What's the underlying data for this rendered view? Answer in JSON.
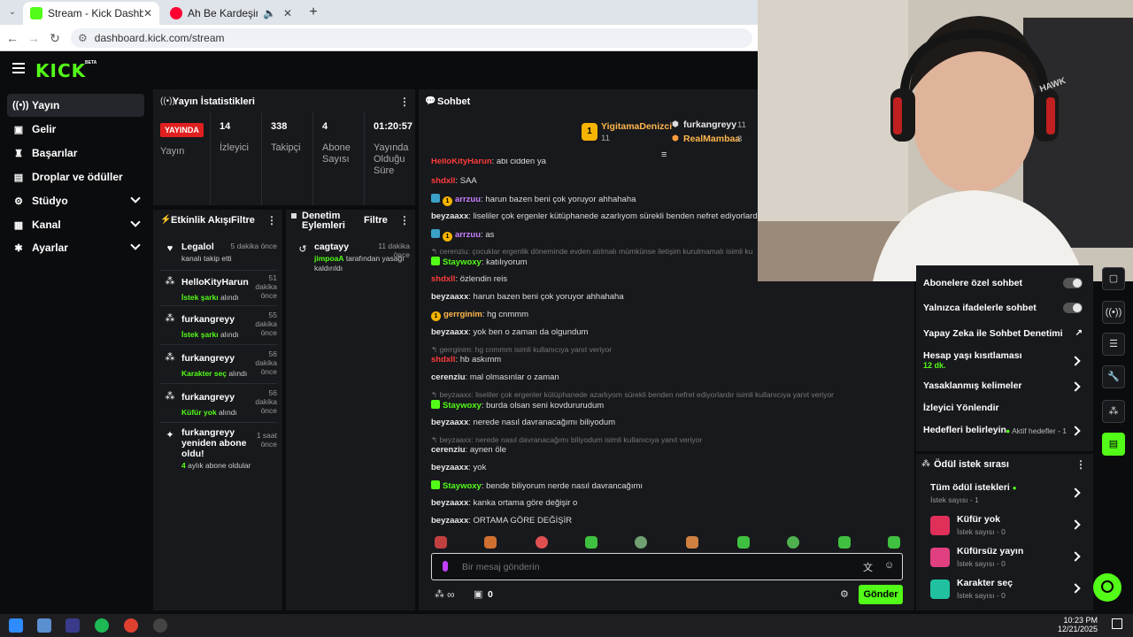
{
  "browser": {
    "tabs": [
      {
        "label": "Stream - Kick Dashboard",
        "active": true
      },
      {
        "label": "Ah Be Kardeşim - YouTube",
        "active": false
      }
    ],
    "url": "dashboard.kick.com/stream"
  },
  "brand": {
    "logo": "KICK",
    "beta": "BETA",
    "accent": "#53fc18"
  },
  "sidebar": {
    "items": [
      {
        "label": "Yayın",
        "icon": "broadcast-icon"
      },
      {
        "label": "Gelir",
        "icon": "wallet-icon"
      },
      {
        "label": "Başarılar",
        "icon": "trophy-icon"
      },
      {
        "label": "Droplar ve ödüller",
        "icon": "gift-icon"
      },
      {
        "label": "Stüdyo",
        "icon": "studio-icon"
      },
      {
        "label": "Kanal",
        "icon": "channel-icon"
      },
      {
        "label": "Ayarlar",
        "icon": "gear-icon"
      }
    ]
  },
  "stats": {
    "title": "Yayın İstatistikleri",
    "live_badge": "YAYINDA",
    "live_label": "Yayın",
    "viewers": {
      "value": "14",
      "label": "İzleyici"
    },
    "followers": {
      "value": "338",
      "label": "Takipçi"
    },
    "subs": {
      "value": "4",
      "label": "Abone Sayısı"
    },
    "uptime": {
      "value": "01:20:57",
      "label": "Yayında Olduğu Süre"
    }
  },
  "activity": {
    "title": "Etkinlik Akışı",
    "filter": "Filtre",
    "items": [
      {
        "user": "Legalol",
        "time": "5 dakika önce",
        "sub_plain": "kanalı takip etti",
        "sub_green": ""
      },
      {
        "user": "HelloKityHarun",
        "time": "51 dakika önce",
        "sub_green": "İstek şarkı",
        "sub_plain": " alındı"
      },
      {
        "user": "furkangreyy",
        "time": "55 dakika önce",
        "sub_green": "İstek şarkı",
        "sub_plain": " alındı"
      },
      {
        "user": "furkangreyy",
        "time": "56 dakika önce",
        "sub_green": "Karakter seç",
        "sub_plain": " alındı"
      },
      {
        "user": "furkangreyy",
        "time": "56 dakika önce",
        "sub_green": "Küfür yok",
        "sub_plain": " alındı"
      },
      {
        "user": "furkangreyy yeniden abone oldu!",
        "time": "1 saat önce",
        "sub_green": "4",
        "sub_plain": " aylık abone oldular"
      }
    ]
  },
  "moderation": {
    "title": "Denetim Eylemleri",
    "filter": "Filtre",
    "items": [
      {
        "user": "cagtayy",
        "time": "11 dakika önce",
        "actor": "jimpoaA",
        "text": " tarafından yasağı kaldırıldı"
      }
    ]
  },
  "chat": {
    "title": "Sohbet",
    "pinned": [
      {
        "user": "YigitamaDenizci",
        "count": "11"
      },
      {
        "user": "furkangreyy",
        "count": "11"
      },
      {
        "user": "RealMambaa",
        "count": "8"
      }
    ],
    "messages": [
      {
        "kind": "msg",
        "user": "HelloKityHarun",
        "color": "red",
        "text": ": abi cidden ya",
        "badge": ""
      },
      {
        "kind": "msg",
        "user": "shdxll",
        "color": "red",
        "text": ": SAA",
        "badge": ""
      },
      {
        "kind": "msg",
        "user": "arrzuu",
        "color": "purple",
        "text": ": harun bazen beni çok yoruyor ahhahaha",
        "badge": "both"
      },
      {
        "kind": "msg",
        "user": "beyzaaxx",
        "color": "white",
        "text": ": liseliler çok ergenler kütüphanede azarlıyom sürekli benden nefret ediyorlardır",
        "badge": ""
      },
      {
        "kind": "msg",
        "user": "arrzuu",
        "color": "purple",
        "text": ": as",
        "badge": "both"
      },
      {
        "kind": "reply",
        "text": "cerenziu: çocuklar ergenlik döneminde evden atılmalı mümkünse iletişim kurulmamalı isimli ku"
      },
      {
        "kind": "msg",
        "user": "Staywoxy",
        "color": "green",
        "text": ": katılıyorum",
        "badge": "gift"
      },
      {
        "kind": "msg",
        "user": "shdxll",
        "color": "red",
        "text": ": özlendin reis",
        "badge": ""
      },
      {
        "kind": "msg",
        "user": "beyzaaxx",
        "color": "white",
        "text": ": harun bazen beni çok yoruyor ahhahaha",
        "badge": ""
      },
      {
        "kind": "msg",
        "user": "gerrginim",
        "color": "gold",
        "text": ": hg cnmmm",
        "badge": "gold"
      },
      {
        "kind": "msg",
        "user": "beyzaaxx",
        "color": "white",
        "text": ": yok ben o zaman da olgundum",
        "badge": ""
      },
      {
        "kind": "reply",
        "text": "gerrginim: hg cnmmm isimli kullanıcıya yanıt veriyor"
      },
      {
        "kind": "msg",
        "user": "shdxll",
        "color": "red",
        "text": ": hb askımm",
        "badge": ""
      },
      {
        "kind": "msg",
        "user": "cerenziu",
        "color": "white",
        "text": ": mal olmasınlar o zaman",
        "badge": ""
      },
      {
        "kind": "reply",
        "text": "beyzaaxx: liseliler çok ergenler kütüphanede azarlıyom sürekli benden nefret ediyorlardır isimli kullanıcıya yanıt veriyor"
      },
      {
        "kind": "msg",
        "user": "Staywoxy",
        "color": "green",
        "text": ": burda olsan seni kovdururudum",
        "badge": "gift"
      },
      {
        "kind": "msg",
        "user": "beyzaaxx",
        "color": "white",
        "text": ": nerede nasıl davranacağımı biliyodum",
        "badge": ""
      },
      {
        "kind": "reply",
        "text": "beyzaaxx: nerede nasıl davranacağımı biliyodum isimli kullanıcıya yanıt veriyor"
      },
      {
        "kind": "msg",
        "user": "cerenziu",
        "color": "white",
        "text": ": aynen öle",
        "badge": ""
      },
      {
        "kind": "msg",
        "user": "beyzaaxx",
        "color": "white",
        "text": ": yok",
        "badge": ""
      },
      {
        "kind": "msg",
        "user": "Staywoxy",
        "color": "green",
        "text": ": bende biliyorum nerde nasıl davrancağımı",
        "badge": "gift"
      },
      {
        "kind": "msg",
        "user": "beyzaaxx",
        "color": "white",
        "text": ": kanka ortama göre değişir o",
        "badge": ""
      },
      {
        "kind": "msg",
        "user": "beyzaaxx",
        "color": "white",
        "text": ": ORTAMA GÖRE DEĞİŞİR",
        "badge": ""
      }
    ],
    "placeholder": "Bir mesaj gönderin",
    "send": "Gönder",
    "points": "∞",
    "gifts": "0"
  },
  "settings": {
    "rows": [
      {
        "label": "Abonelere özel sohbet",
        "control": "toggle"
      },
      {
        "label": "Yalnızca ifadelerle sohbet",
        "control": "toggle"
      },
      {
        "label": "Yapay Zeka ile Sohbet Denetimi",
        "control": "external"
      },
      {
        "label": "Hesap yaşı kısıtlaması",
        "sub": "12 dk.",
        "control": "arrow"
      },
      {
        "label": "Yasaklanmış kelimeler",
        "control": "arrow"
      },
      {
        "label": "İzleyici Yönlendir",
        "control": "none"
      },
      {
        "label": "Hedefleri belirleyin",
        "extra": "Aktif hedefler - 1",
        "control": "arrow"
      }
    ]
  },
  "rewards": {
    "title": "Ödül istek sırası",
    "items": [
      {
        "title": "Tüm ödül istekleri",
        "sub": "İstek sayısı - 1",
        "color": ""
      },
      {
        "title": "Küfür yok",
        "sub": "İstek sayısı - 0",
        "color": "#e0305a"
      },
      {
        "title": "Küfürsüz yayın",
        "sub": "İstek sayısı - 0",
        "color": "#e04080"
      },
      {
        "title": "Karakter seç",
        "sub": "İstek sayısı - 0",
        "color": "#20c0a0"
      }
    ]
  },
  "taskbar": {
    "time": "10:23 PM",
    "date": "12/21/2025"
  }
}
